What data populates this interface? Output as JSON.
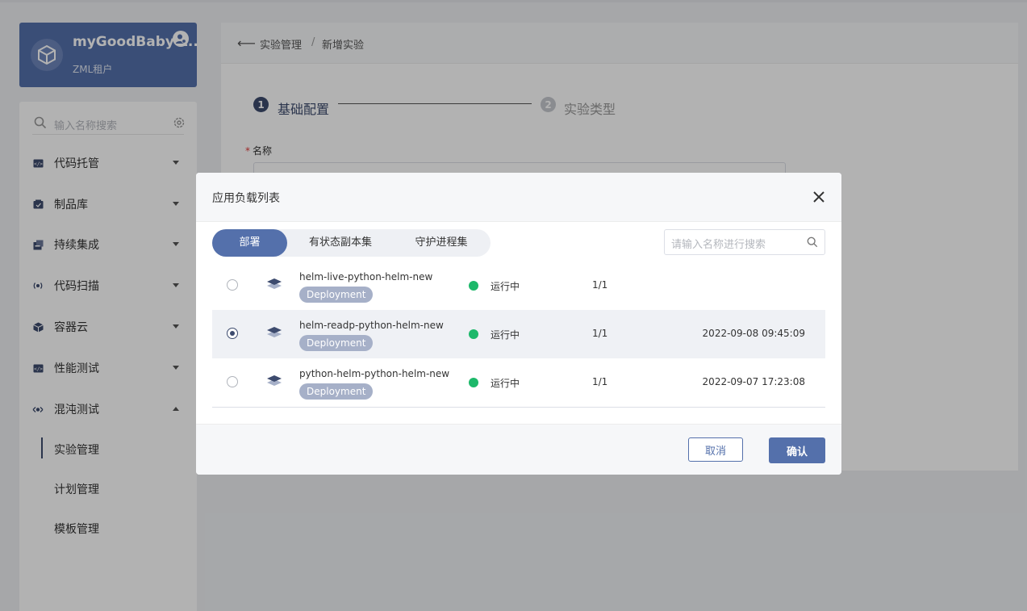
{
  "tenant": {
    "name": "myGoodBaby-z..",
    "type": "ZML租户"
  },
  "sidebar": {
    "search_placeholder": "输入名称搜索",
    "items": [
      {
        "label": "代码托管",
        "icon": "code-icon",
        "expanded": false
      },
      {
        "label": "制品库",
        "icon": "package-icon",
        "expanded": false
      },
      {
        "label": "持续集成",
        "icon": "build-icon",
        "expanded": false
      },
      {
        "label": "代码扫描",
        "icon": "scan-icon",
        "expanded": false
      },
      {
        "label": "容器云",
        "icon": "cube-icon",
        "expanded": false
      },
      {
        "label": "性能测试",
        "icon": "perf-icon",
        "expanded": false
      },
      {
        "label": "混沌测试",
        "icon": "chaos-icon",
        "expanded": true
      }
    ],
    "sub_items": [
      {
        "label": "实验管理",
        "active": true
      },
      {
        "label": "计划管理",
        "active": false
      },
      {
        "label": "模板管理",
        "active": false
      }
    ]
  },
  "breadcrumb": {
    "back": "⟵",
    "parent": "实验管理",
    "separator": "/",
    "current": "新增实验"
  },
  "steps": [
    {
      "num": "1",
      "label": "基础配置",
      "active": true
    },
    {
      "num": "2",
      "label": "实验类型",
      "active": false
    }
  ],
  "form": {
    "name_label": "名称",
    "required_mark": "*"
  },
  "modal": {
    "title": "应用负载列表",
    "tabs": [
      {
        "label": "部署",
        "active": true
      },
      {
        "label": "有状态副本集",
        "active": false
      },
      {
        "label": "守护进程集",
        "active": false
      }
    ],
    "search_placeholder": "请输入名称进行搜索",
    "rows": [
      {
        "name": "helm-live-python-helm-new",
        "kind": "Deployment",
        "status": "运行中",
        "replicas": "1/1",
        "time": "",
        "selected": false
      },
      {
        "name": "helm-readp-python-helm-new",
        "kind": "Deployment",
        "status": "运行中",
        "replicas": "1/1",
        "time": "2022-09-08 09:45:09",
        "selected": true
      },
      {
        "name": "python-helm-python-helm-new",
        "kind": "Deployment",
        "status": "运行中",
        "replicas": "1/1",
        "time": "2022-09-07 17:23:08",
        "selected": false
      }
    ],
    "cancel_label": "取消",
    "confirm_label": "确认"
  },
  "colors": {
    "primary": "#5470ab",
    "running": "#1db86a",
    "tag": "#a6b0c8"
  }
}
